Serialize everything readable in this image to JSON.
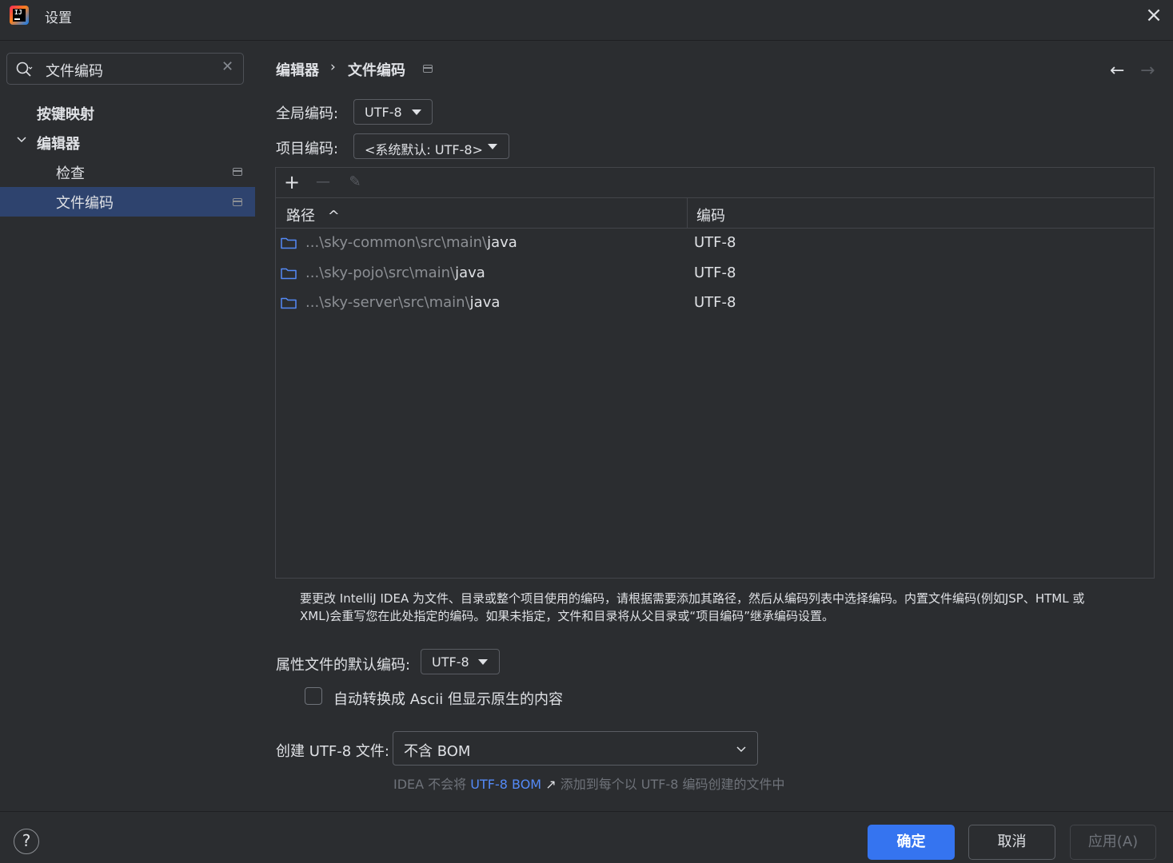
{
  "window": {
    "title": "设置"
  },
  "search": {
    "value": "文件编码"
  },
  "sidebar": {
    "items": [
      {
        "label": "按键映射"
      },
      {
        "label": "编辑器"
      },
      {
        "label": "检查"
      },
      {
        "label": "文件编码"
      }
    ]
  },
  "breadcrumb": {
    "parent": "编辑器",
    "separator": "›",
    "current": "文件编码"
  },
  "nav": {
    "back": "←",
    "forward": "→"
  },
  "global_encoding": {
    "label": "全局编码:",
    "value": "UTF-8"
  },
  "project_encoding": {
    "label": "项目编码:",
    "value": "<系统默认: UTF-8>"
  },
  "toolbar": {
    "add": "+",
    "remove": "—",
    "edit": "✎"
  },
  "table": {
    "columns": {
      "path": "路径",
      "sort_indicator": "^",
      "encoding": "编码"
    },
    "rows": [
      {
        "path_prefix": "...\\sky-common\\src\\main\\",
        "path_last": "java",
        "encoding": "UTF-8"
      },
      {
        "path_prefix": "...\\sky-pojo\\src\\main\\",
        "path_last": "java",
        "encoding": "UTF-8"
      },
      {
        "path_prefix": "...\\sky-server\\src\\main\\",
        "path_last": "java",
        "encoding": "UTF-8"
      }
    ]
  },
  "description": {
    "line1": "要更改 IntelliJ IDEA 为文件、目录或整个项目使用的编码，请根据需要添加其路径，然后从编码列表中选择编码。内置文件编码(例如JSP、HTML 或",
    "line2": "XML)会重写您在此处指定的编码。如果未指定，文件和目录将从父目录或“项目编码”继承编码设置。"
  },
  "properties_encoding": {
    "label": "属性文件的默认编码:",
    "value": "UTF-8"
  },
  "ascii_checkbox": {
    "label": "自动转换成 Ascii 但显示原生的内容",
    "checked": false
  },
  "bom": {
    "label": "创建 UTF-8 文件:",
    "value": "不含 BOM"
  },
  "bom_hint": {
    "prefix": "IDEA 不会将",
    "link": "UTF-8 BOM",
    "link_arrow": "↗",
    "suffix": "添加到每个以 UTF-8 编码创建的文件中"
  },
  "footer": {
    "help": "?",
    "ok": "确定",
    "cancel": "取消",
    "apply": "应用(A)"
  },
  "colors": {
    "accent": "#3574f0",
    "selection": "#2e436e",
    "link": "#548af7",
    "background": "#2b2d30"
  }
}
